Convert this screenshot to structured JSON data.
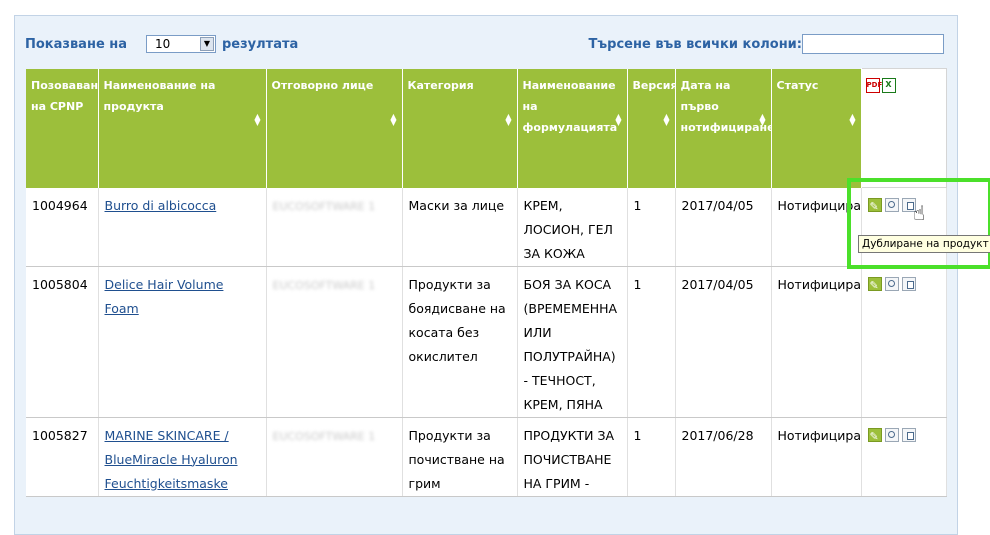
{
  "toolbar": {
    "show_label": "Показване на",
    "page_size": "10",
    "results_label": "резултата",
    "search_label": "Търсене във всички колони:",
    "search_value": ""
  },
  "columns": [
    "Позоваване на CPNP",
    "Наименование на продукта",
    "Отговорно лице",
    "Категория",
    "Наименование на формулацията",
    "Версия",
    "Дата на първо нотифициране",
    "Статус"
  ],
  "rows": [
    {
      "cpnp": "1004964",
      "product": "Burro di albicocca",
      "responsible": "EUCOSOFTWARE 1",
      "category": "Маски за лице",
      "formulation": "КРЕМ, ЛОСИОН, ГЕЛ ЗА КОЖА",
      "version": "1",
      "date": "2017/04/05",
      "status": "Нотифициран(и)"
    },
    {
      "cpnp": "1005804",
      "product": "Delice Hair Volume Foam",
      "responsible": "EUCOSOFTWARE 1",
      "category": "Продукти за боядисване на косата без окислител",
      "formulation": "БОЯ ЗА КОСА (ВРЕМЕМЕННА ИЛИ ПОЛУТРАЙНА) - ТЕЧНОСТ, КРЕМ, ПЯНА",
      "version": "1",
      "date": "2017/04/05",
      "status": "Нотифициран(и)"
    },
    {
      "cpnp": "1005827",
      "product": "MARINE SKINCARE / BlueMiracle Hyaluron Feuchtigkeitsmaske",
      "responsible": "EUCOSOFTWARE 1",
      "category": "Продукти за почистване на грим",
      "formulation": "ПРОДУКТИ ЗА ПОЧИСТВАНЕ НА ГРИМ -",
      "version": "1",
      "date": "2017/06/28",
      "status": "Нотифициран(и)"
    }
  ],
  "tooltip": "Дублиране на продукт",
  "icons": {
    "export": [
      "pdf-icon",
      "excel-icon"
    ],
    "row_actions": [
      "edit-icon",
      "view-icon",
      "duplicate-icon"
    ],
    "cursor": "hand-pointer-icon"
  },
  "colors": {
    "header_bg": "#9cbf3b",
    "panel_bg": "#eaf2fa",
    "link": "#1f4f8f",
    "label": "#2d63a4",
    "highlight": "#4be02a"
  }
}
